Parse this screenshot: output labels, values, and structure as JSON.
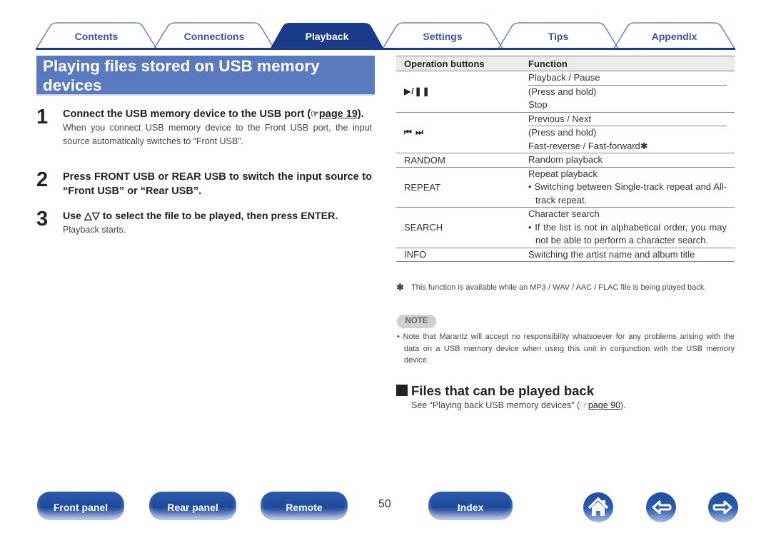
{
  "tabs": [
    {
      "label": "Contents",
      "active": false
    },
    {
      "label": "Connections",
      "active": false
    },
    {
      "label": "Playback",
      "active": true
    },
    {
      "label": "Settings",
      "active": false
    },
    {
      "label": "Tips",
      "active": false
    },
    {
      "label": "Appendix",
      "active": false
    }
  ],
  "colors": {
    "accent": "#1a3a8a",
    "title_bar": "#5a7abf",
    "tab_text": "#3b55a8"
  },
  "page_title": "Playing files stored on USB memory devices",
  "steps": [
    {
      "num": "1",
      "head": "Connect the USB memory device to the USB port (",
      "link": "page 19",
      "head_end": ").",
      "body": "When you connect USB memory device to the Front USB port, the input source automatically switches to “Front USB”."
    },
    {
      "num": "2",
      "head": "Press FRONT USB or REAR USB to switch the input source to “Front USB” or “Rear USB”."
    },
    {
      "num": "3",
      "head": "Use △▽ to select the file to be played, then press ENTER.",
      "body": "Playback starts."
    }
  ],
  "table": {
    "headers": [
      "Operation buttons",
      "Function"
    ],
    "rows": [
      {
        "button": "▶/❚❚",
        "functions": [
          "Playback / Pause",
          "(Press and hold)",
          "Stop"
        ]
      },
      {
        "button": "⏮ ⏭",
        "functions": [
          "Previous / Next",
          "(Press and hold)",
          "Fast-reverse / Fast-forward✱"
        ]
      },
      {
        "button": "RANDOM",
        "functions": [
          "Random playback"
        ]
      },
      {
        "button": "REPEAT",
        "functions": [
          "Repeat playback",
          "• Switching between Single-track repeat and All-track repeat."
        ]
      },
      {
        "button": "SEARCH",
        "functions": [
          "Character search",
          "• If the list is not in alphabetical order, you may not be able to perform a character search."
        ]
      },
      {
        "button": "INFO",
        "functions": [
          "Switching the artist name and album title"
        ]
      }
    ]
  },
  "footnote": {
    "mark": "✱",
    "text": "This function is available while an MP3 / WAV / AAC / FLAC file is being played back."
  },
  "note": {
    "badge": "NOTE",
    "text": "• Note that Marantz will accept no responsibility whatsoever for any problems arising with the data on a USB memory device when using this unit in conjunction with the USB memory device."
  },
  "section": {
    "title": "Files that can be played back",
    "body_pre": "See “Playing back USB memory devices” (",
    "link": "page 90",
    "body_post": ")."
  },
  "hand_icon": "☞",
  "bottom_nav": {
    "buttons": [
      "Front panel",
      "Rear panel",
      "Remote",
      "Index"
    ],
    "page_number": "50",
    "icons": [
      "home-icon",
      "back-arrow-icon",
      "forward-arrow-icon"
    ]
  }
}
